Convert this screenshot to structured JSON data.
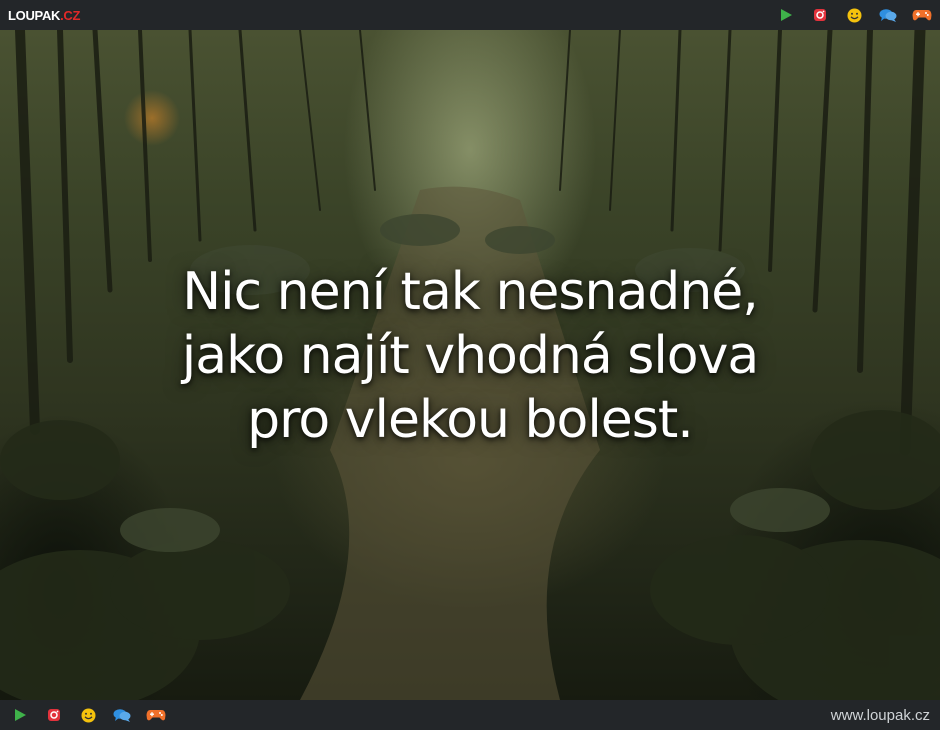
{
  "brand": {
    "name": "LOUPAK",
    "tld": ".CZ",
    "url": "www.loupak.cz"
  },
  "icons": [
    "play-icon",
    "instagram-icon",
    "smiley-icon",
    "chat-bubbles-icon",
    "gamepad-icon"
  ],
  "colors": {
    "bar": "#232629",
    "play": "#3fb24a",
    "instagram": "#e2323c",
    "smiley": "#f4c20d",
    "chat": "#2f8fe0",
    "gamepad": "#f0702a"
  },
  "quote": {
    "lines": [
      "Nic není tak nesnadné,",
      "jako najít vhodná slova",
      "pro vlekou bolest."
    ]
  }
}
